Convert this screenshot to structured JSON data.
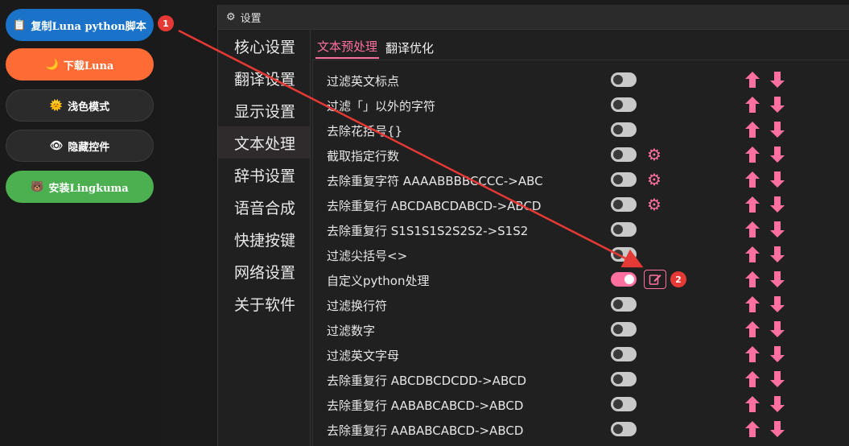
{
  "left_buttons": [
    {
      "label": "复制Luna python脚本",
      "icon": "clipboard-icon",
      "color": "#1a73c8",
      "badge": "1"
    },
    {
      "label": "下载Luna",
      "icon": "moon-icon",
      "color": "#ff6b35"
    },
    {
      "label": "浅色模式",
      "icon": "sun-icon",
      "color": "#2b2b2b"
    },
    {
      "label": "隐藏控件",
      "icon": "eye-icon",
      "color": "#2b2b2b"
    },
    {
      "label": "安装Lingkuma",
      "icon": "bear-icon",
      "color": "#4caf50"
    }
  ],
  "window": {
    "title": "设置"
  },
  "sidebar": {
    "items": [
      {
        "label": "核心设置"
      },
      {
        "label": "翻译设置"
      },
      {
        "label": "显示设置"
      },
      {
        "label": "文本处理",
        "active": true
      },
      {
        "label": "辞书设置"
      },
      {
        "label": "语音合成"
      },
      {
        "label": "快捷按键"
      },
      {
        "label": "网络设置"
      },
      {
        "label": "关于软件"
      }
    ]
  },
  "tabs": [
    {
      "label": "文本预处理",
      "active": true
    },
    {
      "label": "翻译优化"
    }
  ],
  "rows": [
    {
      "label": "过滤英文标点",
      "on": false,
      "extra": "none"
    },
    {
      "label": "过滤「」以外的字符",
      "on": false,
      "extra": "none"
    },
    {
      "label": "去除花括号{}",
      "on": false,
      "extra": "none"
    },
    {
      "label": "截取指定行数",
      "on": false,
      "extra": "gear"
    },
    {
      "label": "去除重复字符 AAAABBBBCCCC->ABC",
      "on": false,
      "extra": "gear"
    },
    {
      "label": "去除重复行 ABCDABCDABCD->ABCD",
      "on": false,
      "extra": "gear"
    },
    {
      "label": "去除重复行 S1S1S1S2S2S2->S1S2",
      "on": false,
      "extra": "none"
    },
    {
      "label": "过滤尖括号<>",
      "on": false,
      "extra": "none"
    },
    {
      "label": "自定义python处理",
      "on": true,
      "extra": "edit",
      "badge": "2"
    },
    {
      "label": "过滤换行符",
      "on": false,
      "extra": "none"
    },
    {
      "label": "过滤数字",
      "on": false,
      "extra": "none"
    },
    {
      "label": "过滤英文字母",
      "on": false,
      "extra": "none"
    },
    {
      "label": "去除重复行 ABCDBCDCDD->ABCD",
      "on": false,
      "extra": "none"
    },
    {
      "label": "去除重复行 AABABCABCD->ABCD",
      "on": false,
      "extra": "none"
    },
    {
      "label": "去除重复行 AABABCABCD->ABCD",
      "on": false,
      "extra": "none"
    }
  ],
  "colors": {
    "accent": "#ff6f9f",
    "annotation": "#e53935"
  }
}
